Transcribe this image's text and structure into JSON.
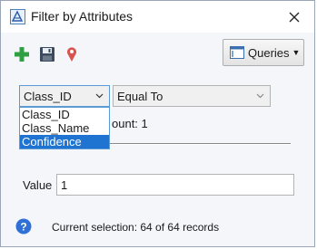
{
  "window": {
    "title": "Filter by Attributes"
  },
  "toolbar": {
    "add_icon": "plus-icon",
    "save_icon": "floppy-disk-icon",
    "pin_icon": "map-pin-icon",
    "queries_label": "Queries",
    "queries_icon": "query-list-icon"
  },
  "filter": {
    "field_selected": "Class_ID",
    "operator_selected": "Equal To",
    "field_options": [
      "Class_ID",
      "Class_Name",
      "Confidence"
    ],
    "highlighted_option": "Confidence",
    "count_label": "ount: 1",
    "value_label": "Value",
    "value": "1"
  },
  "status": {
    "help_icon": "help-icon",
    "text": "Current selection: 64 of 64 records"
  },
  "colors": {
    "highlight": "#1e74d0",
    "add_green": "#2ea043",
    "pin_red": "#d9534f",
    "help_blue": "#2f6fd6"
  }
}
